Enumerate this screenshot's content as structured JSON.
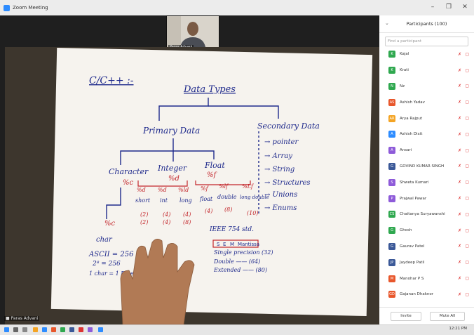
{
  "window": {
    "title": "Zoom Meeting",
    "minimize": "–",
    "maximize": "❐",
    "close": "✕"
  },
  "self_view": {
    "name": "Paras Advani"
  },
  "video": {
    "bottom_label": "■ Paras Advani",
    "whiteboard": {
      "heading": "C/C++ :-",
      "root": "Data Types",
      "primary": "Primary Data",
      "secondary": "Secondary Data",
      "secondary_items": [
        "→ pointer",
        "→ Array",
        "→ String",
        "→ Structures",
        "→ Unions",
        "→ Enums"
      ],
      "character": "Character",
      "character_fmt": "%c",
      "integer": "Integer",
      "integer_fmt": "%d",
      "float": "Float",
      "float_fmt": "%f",
      "char_fmt": "%c",
      "char_type": "char",
      "ascii": "ASCII = 256",
      "pow": "2⁸ = 256",
      "char_byte": "1 char = 1 Byte",
      "int_fmts": [
        "%d",
        "%d",
        "%ld"
      ],
      "int_types": [
        "short",
        "int",
        "long"
      ],
      "int_sizes": [
        "(2)",
        "(4)",
        "(4)"
      ],
      "int_sizes2": [
        "(2)",
        "(4)",
        "(8)"
      ],
      "float_fmts": [
        "%f",
        "%lf",
        "%Lf"
      ],
      "float_types": [
        "float",
        "double",
        "long double"
      ],
      "float_sizes": [
        "(4)",
        "(8)",
        "(10)"
      ],
      "ieee": "IEEE 754 std.",
      "ieee_cells": [
        "S",
        "E",
        "M",
        "Mantissa"
      ],
      "prec": [
        "Single precision (32)",
        "Double —— (64)",
        "Extended —— (80)"
      ]
    }
  },
  "participants": {
    "title": "Participants (100)",
    "search_placeholder": "Find a participant",
    "items": [
      {
        "initial": "K",
        "name": "Kajal",
        "color": "#2fa84f"
      },
      {
        "initial": "K",
        "name": "Krati",
        "color": "#2fa84f"
      },
      {
        "initial": "N",
        "name": "Nz",
        "color": "#2fa84f"
      },
      {
        "initial": "AS",
        "name": "Ashish Yadav",
        "color": "#e8572c"
      },
      {
        "initial": "AR",
        "name": "Arya Rajput",
        "color": "#f4a424"
      },
      {
        "initial": "A",
        "name": "Ashish Dixit",
        "color": "#2d8cff"
      },
      {
        "initial": "A",
        "name": "Ansari",
        "color": "#8e5bd9"
      },
      {
        "initial": "G",
        "name": "GOVIND KUMAR SINGH",
        "color": "#3b5998"
      },
      {
        "initial": "S",
        "name": "Shweta Kumari",
        "color": "#8e5bd9"
      },
      {
        "initial": "P",
        "name": "Prajwal Pawar",
        "color": "#8e5bd9"
      },
      {
        "initial": "CS",
        "name": "Chaitanya Suryawanshi",
        "color": "#2fa84f"
      },
      {
        "initial": "G",
        "name": "Ghosh",
        "color": "#2fa84f"
      },
      {
        "initial": "G",
        "name": "Gaurav Patel",
        "color": "#3b5998"
      },
      {
        "initial": "JP",
        "name": "Jaydeep Patil",
        "color": "#3b5998"
      },
      {
        "initial": "M",
        "name": "Manohar P S",
        "color": "#e8572c"
      },
      {
        "initial": "GD",
        "name": "Gajanan Dhaknor",
        "color": "#e8572c"
      }
    ],
    "invite_label": "Invite",
    "mute_all_label": "Mute All"
  },
  "taskbar": {
    "time": "12:21 PM"
  }
}
